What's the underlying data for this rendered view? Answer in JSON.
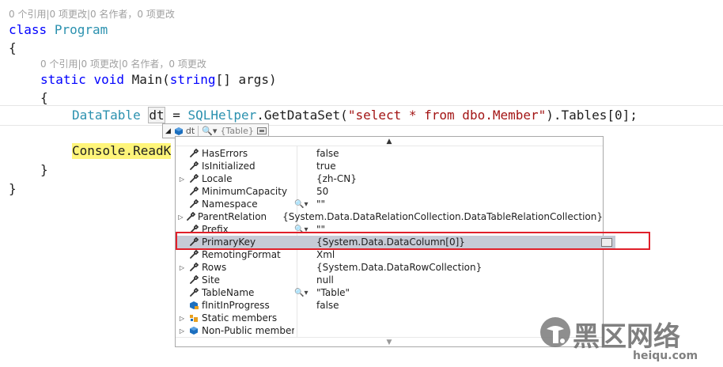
{
  "code": {
    "lens1": "0 个引用|0 项更改|0 名作者，0 项更改",
    "lens2": "0 个引用|0 项更改|0 名作者，0 项更改",
    "l_class_kw": "class",
    "l_class_name": "Program",
    "brace_open": "{",
    "brace_close": "}",
    "main_static": "static",
    "main_void": "void",
    "main_name": " Main(",
    "main_string": "string",
    "main_args": "[] args)",
    "dt_type": "DataTable",
    "dt_var": "dt",
    "dt_eq": " = ",
    "dt_helper": "SQLHelper",
    "dt_call": ".GetDataSet(",
    "dt_sql": "\"select * from dbo.Member\"",
    "dt_tail": ").Tables[0];",
    "console_line": "Console.ReadK"
  },
  "datatip": {
    "header_var": "dt",
    "header_value": "{Table}",
    "properties": [
      {
        "name": "HasErrors",
        "value": "false",
        "expandable": false,
        "lens": false,
        "icon": "wrench-icon"
      },
      {
        "name": "IsInitialized",
        "value": "true",
        "expandable": false,
        "lens": false,
        "icon": "wrench-icon"
      },
      {
        "name": "Locale",
        "value": "{zh-CN}",
        "expandable": true,
        "lens": false,
        "icon": "wrench-icon"
      },
      {
        "name": "MinimumCapacity",
        "value": "50",
        "expandable": false,
        "lens": false,
        "icon": "wrench-icon"
      },
      {
        "name": "Namespace",
        "value": "\"\"",
        "expandable": false,
        "lens": true,
        "icon": "wrench-icon"
      },
      {
        "name": "ParentRelations",
        "value": "{System.Data.DataRelationCollection.DataTableRelationCollection}",
        "expandable": true,
        "lens": false,
        "icon": "wrench-icon"
      },
      {
        "name": "Prefix",
        "value": "\"\"",
        "expandable": false,
        "lens": true,
        "icon": "wrench-icon"
      },
      {
        "name": "PrimaryKey",
        "value": "{System.Data.DataColumn[0]}",
        "expandable": false,
        "lens": false,
        "icon": "wrench-icon",
        "selected": true
      },
      {
        "name": "RemotingFormat",
        "value": "Xml",
        "expandable": false,
        "lens": false,
        "icon": "wrench-icon"
      },
      {
        "name": "Rows",
        "value": "{System.Data.DataRowCollection}",
        "expandable": true,
        "lens": false,
        "icon": "wrench-icon"
      },
      {
        "name": "Site",
        "value": "null",
        "expandable": false,
        "lens": false,
        "icon": "wrench-icon"
      },
      {
        "name": "TableName",
        "value": "\"Table\"",
        "expandable": false,
        "lens": true,
        "icon": "wrench-icon"
      },
      {
        "name": "fInitInProgress",
        "value": "false",
        "expandable": false,
        "lens": false,
        "icon": "field-icon"
      },
      {
        "name": "Static members",
        "value": "",
        "expandable": true,
        "lens": false,
        "icon": "static-members-icon"
      },
      {
        "name": "Non-Public members",
        "value": "",
        "expandable": true,
        "lens": false,
        "icon": "nonpublic-members-icon"
      }
    ]
  },
  "watermark": {
    "cn": "黑区网络",
    "en": "heiqu.com"
  },
  "colors": {
    "keyword": "#0000ff",
    "type": "#2b91af",
    "string": "#a31515",
    "selected_row": "#c6cbd6",
    "highlight_box": "#e0202a",
    "current_statement": "#fff57a"
  }
}
